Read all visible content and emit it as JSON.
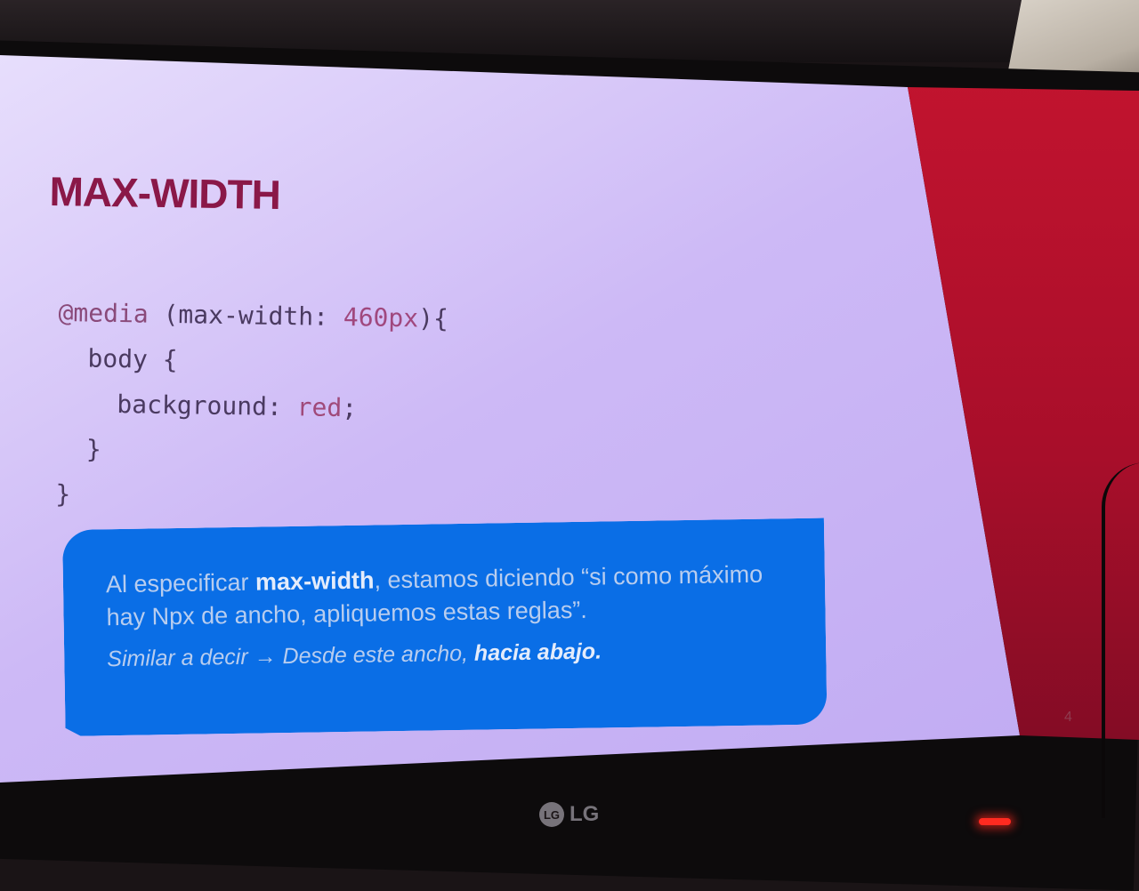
{
  "slide": {
    "title": "MAX-WIDTH",
    "code": {
      "line1_at": "@media",
      "line1_mid": " (max-width: ",
      "line1_num": "460px",
      "line1_end": "){",
      "line2": "  body {",
      "line3_prop": "    background: ",
      "line3_val": "red",
      "line3_end": ";",
      "line4": "  }",
      "line5": "}"
    },
    "note": {
      "p1_start": "Al especificar ",
      "p1_bold": "max-width",
      "p1_end": ", estamos diciendo “si como máximo hay Npx de ancho, apliquemos estas reglas”.",
      "p2_start": "Similar a decir → Desde este ancho, ",
      "p2_bold": "hacia abajo."
    },
    "page_number": "4"
  },
  "monitor": {
    "brand": "LG",
    "brand_mark": "LG"
  },
  "colors": {
    "title": "#8a1848",
    "slide_bg": "#d4c4f8",
    "note_bg": "#0a6ee6",
    "side_panel": "#b0102c"
  }
}
